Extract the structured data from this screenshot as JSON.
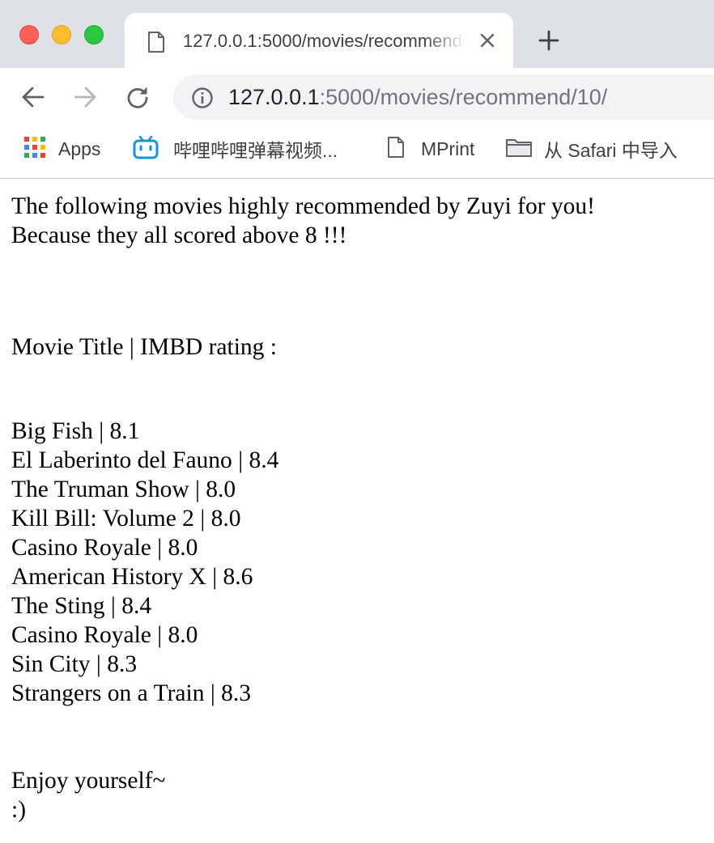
{
  "browser": {
    "tab": {
      "title": "127.0.0.1:5000/movies/recommend/10/"
    },
    "address": {
      "host": "127.0.0.1",
      "path": ":5000/movies/recommend/10/"
    },
    "bookmarks": [
      {
        "label": "Apps",
        "icon": "apps-grid-icon"
      },
      {
        "label": "哔哩哔哩弹幕视频...",
        "icon": "bilibili-icon"
      },
      {
        "label": "MPrint",
        "icon": "page-icon"
      },
      {
        "label": "从 Safari 中导入",
        "icon": "folder-icon"
      }
    ]
  },
  "page": {
    "intro": [
      "The following movies highly recommended by Zuyi for you!",
      "Because they all scored above 8 !!!"
    ],
    "table_header": "Movie Title | IMBD rating :",
    "movies": [
      {
        "title": "Big Fish",
        "rating": "8.1"
      },
      {
        "title": "El Laberinto del Fauno",
        "rating": "8.4"
      },
      {
        "title": "The Truman Show",
        "rating": "8.0"
      },
      {
        "title": "Kill Bill: Volume 2",
        "rating": "8.0"
      },
      {
        "title": "Casino Royale",
        "rating": "8.0"
      },
      {
        "title": "American History X",
        "rating": "8.6"
      },
      {
        "title": "The Sting",
        "rating": "8.4"
      },
      {
        "title": "Casino Royale",
        "rating": "8.0"
      },
      {
        "title": "Sin City",
        "rating": "8.3"
      },
      {
        "title": "Strangers on a Train",
        "rating": "8.3"
      }
    ],
    "separator": " | ",
    "outro": [
      "Enjoy yourself~",
      ":)"
    ]
  }
}
